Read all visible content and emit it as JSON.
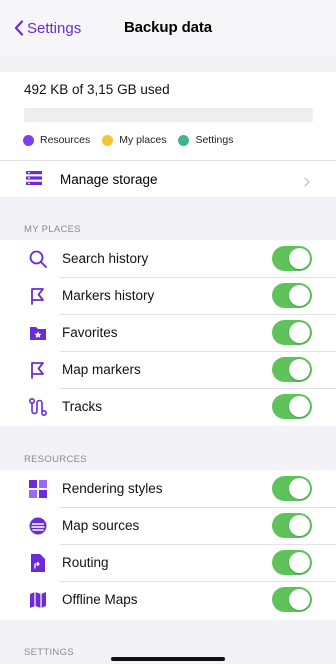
{
  "nav": {
    "back_label": "Settings",
    "title": "Backup data"
  },
  "storage": {
    "usage_text": "492 KB of 3,15 GB used",
    "used_fraction": 0.0,
    "legend": [
      {
        "label": "Resources",
        "color": "#7a3ff0"
      },
      {
        "label": "My places",
        "color": "#f4c534"
      },
      {
        "label": "Settings",
        "color": "#3fb48b"
      }
    ],
    "manage_label": "Manage storage"
  },
  "sections": {
    "my_places": {
      "header": "MY PLACES",
      "items": [
        {
          "label": "Search history",
          "icon": "search-icon",
          "enabled": true
        },
        {
          "label": "Markers history",
          "icon": "flag-icon",
          "enabled": true
        },
        {
          "label": "Favorites",
          "icon": "favorites-folder-icon",
          "enabled": true
        },
        {
          "label": "Map markers",
          "icon": "flag-icon",
          "enabled": true
        },
        {
          "label": "Tracks",
          "icon": "route-icon",
          "enabled": true
        }
      ]
    },
    "resources": {
      "header": "RESOURCES",
      "items": [
        {
          "label": "Rendering styles",
          "icon": "map-style-icon",
          "enabled": true
        },
        {
          "label": "Map sources",
          "icon": "layers-icon",
          "enabled": true
        },
        {
          "label": "Routing",
          "icon": "routing-file-icon",
          "enabled": true
        },
        {
          "label": "Offline Maps",
          "icon": "map-icon",
          "enabled": true
        }
      ]
    },
    "settings": {
      "header": "SETTINGS"
    }
  },
  "colors": {
    "accent": "#6c2bd9",
    "toggle_on": "#5fc35c",
    "background": "#f2f2f7"
  }
}
